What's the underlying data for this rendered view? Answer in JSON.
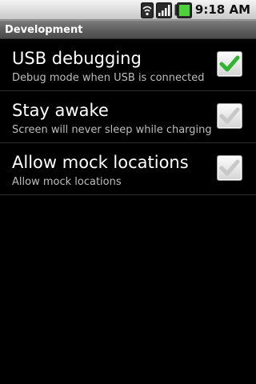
{
  "status_bar": {
    "time": "9:18 AM",
    "icons": [
      "wifi-icon",
      "signal-icon",
      "battery-icon"
    ]
  },
  "header": {
    "title": "Development"
  },
  "preferences": [
    {
      "title": "USB debugging",
      "summary": "Debug mode when USB is connected",
      "checked": true,
      "enabled": true
    },
    {
      "title": "Stay awake",
      "summary": "Screen will never sleep while charging",
      "checked": true,
      "enabled": false
    },
    {
      "title": "Allow mock locations",
      "summary": "Allow mock locations",
      "checked": true,
      "enabled": false
    }
  ],
  "colors": {
    "check_active": "#2fb52f",
    "check_inactive": "#c8c8c8",
    "background": "#000000",
    "title_bar": "#5d5d5d"
  }
}
